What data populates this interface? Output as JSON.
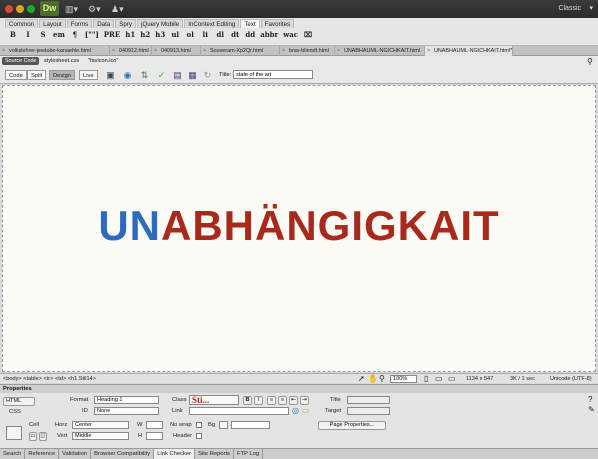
{
  "app": {
    "logo": "Dw",
    "workspace": "Classic"
  },
  "app_menus": [
    "layout-icon",
    "gear-icon",
    "extend-icon"
  ],
  "insert_tabs": [
    "Common",
    "Layout",
    "Forms",
    "Data",
    "Spry",
    "jQuery Mobile",
    "InContext Editing",
    "Text",
    "Favorites"
  ],
  "insert_active": "Text",
  "text_tools": [
    "B",
    "I",
    "S",
    "em",
    "¶",
    "[\"\"]",
    "PRE",
    "h1",
    "h2",
    "h3",
    "ul",
    "ol",
    "li",
    "dl",
    "dt",
    "dd",
    "abbr",
    "wac",
    "⌧"
  ],
  "doc_tabs": [
    "volkslehrer-jewtube-kanaehle.html",
    "040912.html",
    "040913.html",
    "Souveram-Xp2Qr.html",
    "brav-blinndt.html",
    "UNABHAUML-NGICHKAIT.html",
    "UNABHAUML-NGICHKAIT.html*"
  ],
  "related": {
    "source_code": "Source Code",
    "files": [
      "stylesheet.css",
      "\"favicon.ico\""
    ]
  },
  "view": {
    "modes": [
      "Code",
      "Split",
      "Design",
      "Live"
    ],
    "active": "Design",
    "title_label": "Title:",
    "title_value": "state of the art"
  },
  "document": {
    "part1": "UN",
    "part2": "ABHÄNGIGKAIT",
    "color1": "#2f6bbd",
    "color2": "#a92a1c"
  },
  "status": {
    "tags": "<body> <table> <tr> <td> <h1.Stil14>",
    "zoom": "100%",
    "dimensions": "1134 x 547",
    "size": "3K / 1 sec",
    "encoding": "Unicode (UTF-8)"
  },
  "properties": {
    "panel_title": "Properties",
    "html_label": "HTML",
    "css_label": "CSS",
    "format_label": "Format",
    "format_value": "Heading 1",
    "class_label": "Class",
    "class_value": "Sti...",
    "id_label": "ID",
    "id_value": "None",
    "link_label": "Link",
    "title_label": "Title",
    "target_label": "Target",
    "cell_label": "Cell",
    "horz_label": "Horz",
    "horz_value": "Center",
    "vert_label": "Vert",
    "vert_value": "Middle",
    "w_label": "W",
    "h_label": "H",
    "nowrap_label": "No wrap",
    "header_label": "Header",
    "bg_label": "Bg",
    "page_props": "Page Properties..."
  },
  "panel_tabs": [
    "Search",
    "Reference",
    "Validation",
    "Browser Compatibility",
    "Link Checker",
    "Site Reports",
    "FTP Log"
  ],
  "panel_active": "Link Checker"
}
